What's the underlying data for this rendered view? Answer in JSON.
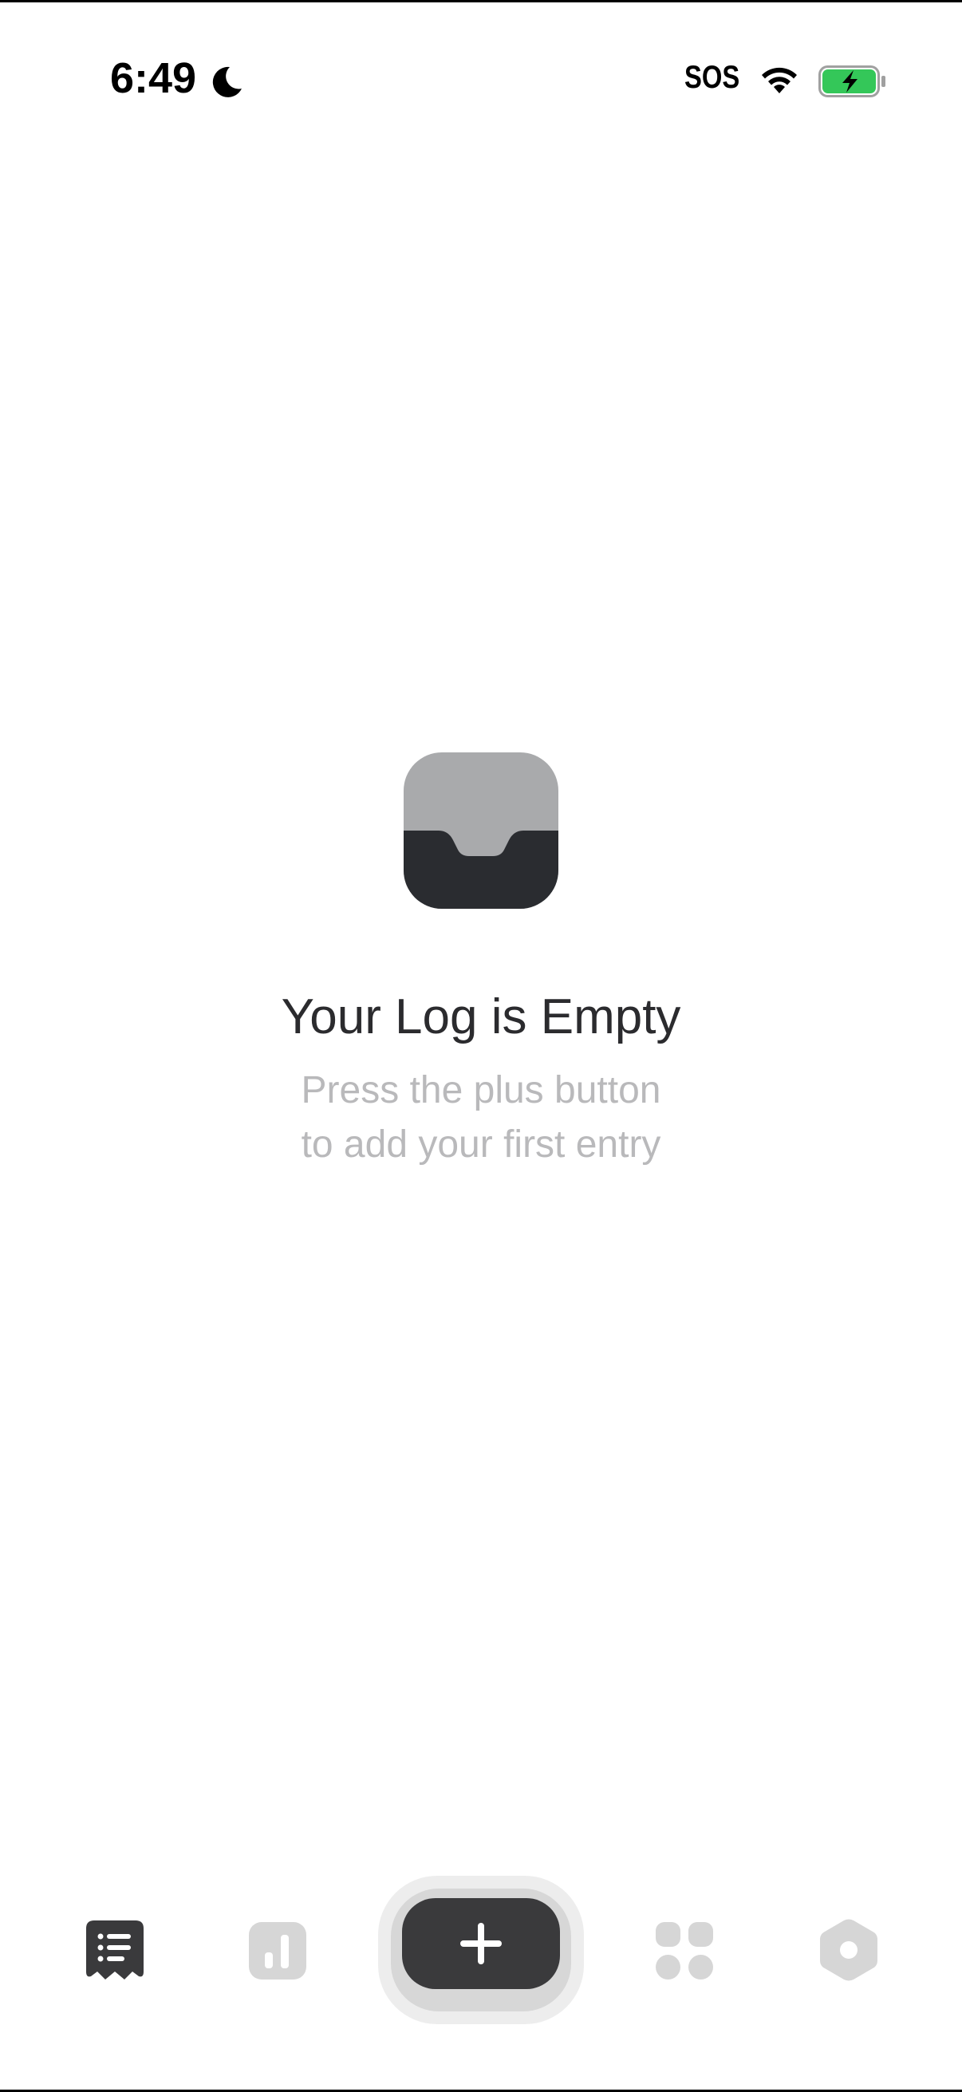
{
  "status_bar": {
    "time": "6:49",
    "focus_icon": "moon-icon",
    "carrier": "SOS",
    "wifi_icon": "wifi-icon",
    "battery_icon": "battery-charging-icon",
    "battery_color": "#34c759"
  },
  "empty_state": {
    "icon": "inbox-icon",
    "title": "Your Log is Empty",
    "subtitle_line1": "Press the plus button",
    "subtitle_line2": "to add your first entry"
  },
  "tab_bar": {
    "items": [
      {
        "icon": "log-icon",
        "selected": true
      },
      {
        "icon": "chart-icon",
        "selected": false
      },
      {
        "icon": "plus-icon",
        "selected": false
      },
      {
        "icon": "grid-icon",
        "selected": false
      },
      {
        "icon": "hexagon-settings-icon",
        "selected": false
      }
    ],
    "active_color": "#3a3a3c",
    "inactive_color": "#d6d6d6"
  }
}
